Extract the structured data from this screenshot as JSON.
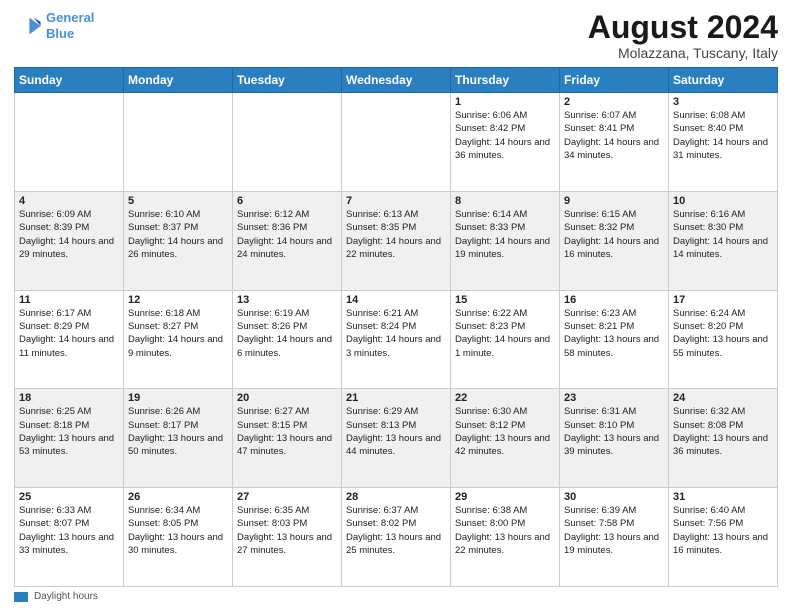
{
  "logo": {
    "line1": "General",
    "line2": "Blue"
  },
  "title": "August 2024",
  "subtitle": "Molazzana, Tuscany, Italy",
  "days_header": [
    "Sunday",
    "Monday",
    "Tuesday",
    "Wednesday",
    "Thursday",
    "Friday",
    "Saturday"
  ],
  "footer_label": "Daylight hours",
  "weeks": [
    [
      {
        "day": "",
        "info": ""
      },
      {
        "day": "",
        "info": ""
      },
      {
        "day": "",
        "info": ""
      },
      {
        "day": "",
        "info": ""
      },
      {
        "day": "1",
        "info": "Sunrise: 6:06 AM\nSunset: 8:42 PM\nDaylight: 14 hours and 36 minutes."
      },
      {
        "day": "2",
        "info": "Sunrise: 6:07 AM\nSunset: 8:41 PM\nDaylight: 14 hours and 34 minutes."
      },
      {
        "day": "3",
        "info": "Sunrise: 6:08 AM\nSunset: 8:40 PM\nDaylight: 14 hours and 31 minutes."
      }
    ],
    [
      {
        "day": "4",
        "info": "Sunrise: 6:09 AM\nSunset: 8:39 PM\nDaylight: 14 hours and 29 minutes."
      },
      {
        "day": "5",
        "info": "Sunrise: 6:10 AM\nSunset: 8:37 PM\nDaylight: 14 hours and 26 minutes."
      },
      {
        "day": "6",
        "info": "Sunrise: 6:12 AM\nSunset: 8:36 PM\nDaylight: 14 hours and 24 minutes."
      },
      {
        "day": "7",
        "info": "Sunrise: 6:13 AM\nSunset: 8:35 PM\nDaylight: 14 hours and 22 minutes."
      },
      {
        "day": "8",
        "info": "Sunrise: 6:14 AM\nSunset: 8:33 PM\nDaylight: 14 hours and 19 minutes."
      },
      {
        "day": "9",
        "info": "Sunrise: 6:15 AM\nSunset: 8:32 PM\nDaylight: 14 hours and 16 minutes."
      },
      {
        "day": "10",
        "info": "Sunrise: 6:16 AM\nSunset: 8:30 PM\nDaylight: 14 hours and 14 minutes."
      }
    ],
    [
      {
        "day": "11",
        "info": "Sunrise: 6:17 AM\nSunset: 8:29 PM\nDaylight: 14 hours and 11 minutes."
      },
      {
        "day": "12",
        "info": "Sunrise: 6:18 AM\nSunset: 8:27 PM\nDaylight: 14 hours and 9 minutes."
      },
      {
        "day": "13",
        "info": "Sunrise: 6:19 AM\nSunset: 8:26 PM\nDaylight: 14 hours and 6 minutes."
      },
      {
        "day": "14",
        "info": "Sunrise: 6:21 AM\nSunset: 8:24 PM\nDaylight: 14 hours and 3 minutes."
      },
      {
        "day": "15",
        "info": "Sunrise: 6:22 AM\nSunset: 8:23 PM\nDaylight: 14 hours and 1 minute."
      },
      {
        "day": "16",
        "info": "Sunrise: 6:23 AM\nSunset: 8:21 PM\nDaylight: 13 hours and 58 minutes."
      },
      {
        "day": "17",
        "info": "Sunrise: 6:24 AM\nSunset: 8:20 PM\nDaylight: 13 hours and 55 minutes."
      }
    ],
    [
      {
        "day": "18",
        "info": "Sunrise: 6:25 AM\nSunset: 8:18 PM\nDaylight: 13 hours and 53 minutes."
      },
      {
        "day": "19",
        "info": "Sunrise: 6:26 AM\nSunset: 8:17 PM\nDaylight: 13 hours and 50 minutes."
      },
      {
        "day": "20",
        "info": "Sunrise: 6:27 AM\nSunset: 8:15 PM\nDaylight: 13 hours and 47 minutes."
      },
      {
        "day": "21",
        "info": "Sunrise: 6:29 AM\nSunset: 8:13 PM\nDaylight: 13 hours and 44 minutes."
      },
      {
        "day": "22",
        "info": "Sunrise: 6:30 AM\nSunset: 8:12 PM\nDaylight: 13 hours and 42 minutes."
      },
      {
        "day": "23",
        "info": "Sunrise: 6:31 AM\nSunset: 8:10 PM\nDaylight: 13 hours and 39 minutes."
      },
      {
        "day": "24",
        "info": "Sunrise: 6:32 AM\nSunset: 8:08 PM\nDaylight: 13 hours and 36 minutes."
      }
    ],
    [
      {
        "day": "25",
        "info": "Sunrise: 6:33 AM\nSunset: 8:07 PM\nDaylight: 13 hours and 33 minutes."
      },
      {
        "day": "26",
        "info": "Sunrise: 6:34 AM\nSunset: 8:05 PM\nDaylight: 13 hours and 30 minutes."
      },
      {
        "day": "27",
        "info": "Sunrise: 6:35 AM\nSunset: 8:03 PM\nDaylight: 13 hours and 27 minutes."
      },
      {
        "day": "28",
        "info": "Sunrise: 6:37 AM\nSunset: 8:02 PM\nDaylight: 13 hours and 25 minutes."
      },
      {
        "day": "29",
        "info": "Sunrise: 6:38 AM\nSunset: 8:00 PM\nDaylight: 13 hours and 22 minutes."
      },
      {
        "day": "30",
        "info": "Sunrise: 6:39 AM\nSunset: 7:58 PM\nDaylight: 13 hours and 19 minutes."
      },
      {
        "day": "31",
        "info": "Sunrise: 6:40 AM\nSunset: 7:56 PM\nDaylight: 13 hours and 16 minutes."
      }
    ]
  ]
}
